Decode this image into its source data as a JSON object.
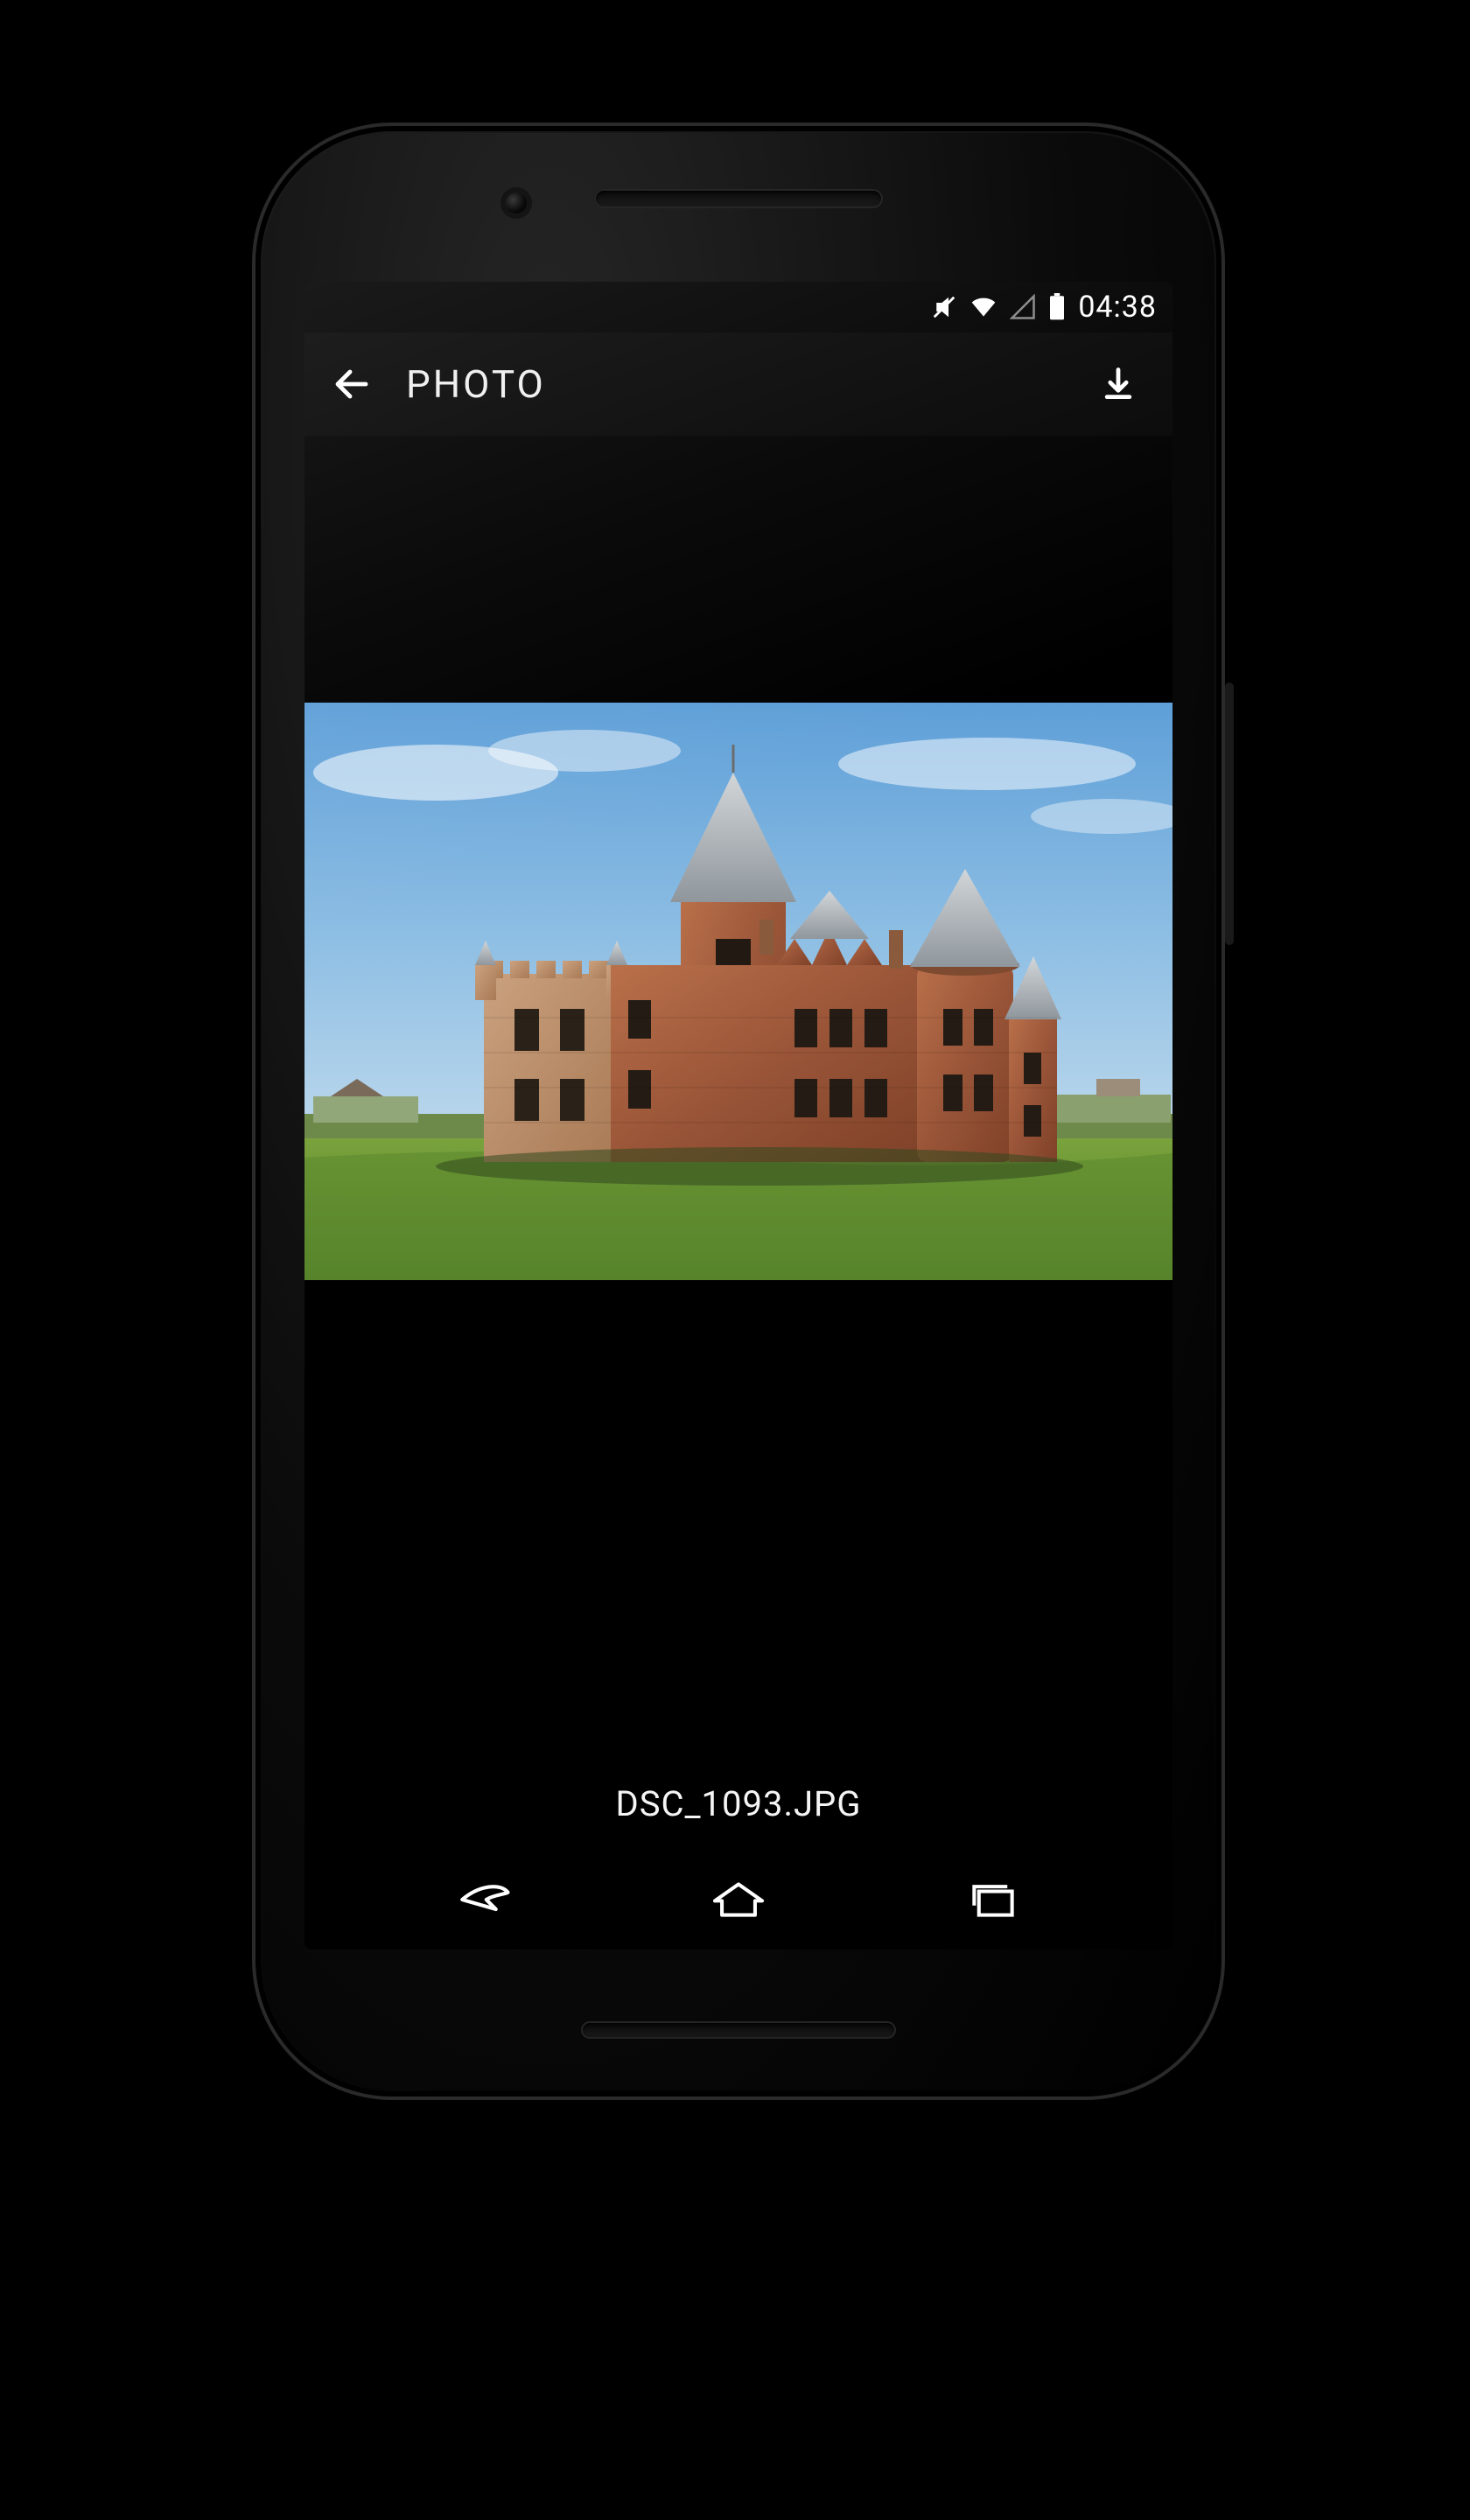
{
  "statusbar": {
    "time": "04:38"
  },
  "appbar": {
    "title": "PHOTO"
  },
  "photo": {
    "filename": "DSC_1093.JPG"
  }
}
